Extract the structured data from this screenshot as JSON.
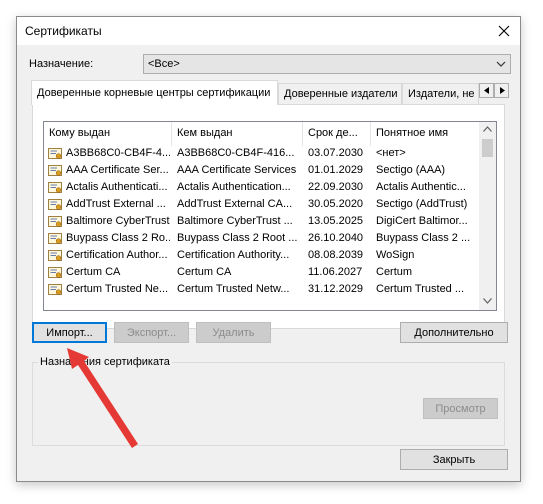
{
  "window": {
    "title": "Сертификаты"
  },
  "purpose": {
    "label": "Назначение:",
    "value": "<Все>"
  },
  "tabs": [
    {
      "label": "Доверенные корневые центры сертификации"
    },
    {
      "label": "Доверенные издатели"
    },
    {
      "label": "Издатели, не"
    }
  ],
  "table": {
    "columns": [
      "Кому выдан",
      "Кем выдан",
      "Срок де...",
      "Понятное имя"
    ],
    "rows": [
      {
        "issued_to": "A3BB68C0-CB4F-4...",
        "issued_by": "A3BB68C0-CB4F-416...",
        "expires": "03.07.2030",
        "friendly": "<нет>"
      },
      {
        "issued_to": "AAA Certificate Ser...",
        "issued_by": "AAA Certificate Services",
        "expires": "01.01.2029",
        "friendly": "Sectigo (AAA)"
      },
      {
        "issued_to": "Actalis Authenticati...",
        "issued_by": "Actalis Authentication...",
        "expires": "22.09.2030",
        "friendly": "Actalis Authentic..."
      },
      {
        "issued_to": "AddTrust External ...",
        "issued_by": "AddTrust External CA...",
        "expires": "30.05.2020",
        "friendly": "Sectigo (AddTrust)"
      },
      {
        "issued_to": "Baltimore CyberTrust...",
        "issued_by": "Baltimore CyberTrust ...",
        "expires": "13.05.2025",
        "friendly": "DigiCert Baltimor..."
      },
      {
        "issued_to": "Buypass Class 2 Ro...",
        "issued_by": "Buypass Class 2 Root ...",
        "expires": "26.10.2040",
        "friendly": "Buypass Class 2 ..."
      },
      {
        "issued_to": "Certification Author...",
        "issued_by": "Certification Authority...",
        "expires": "08.08.2039",
        "friendly": "WoSign"
      },
      {
        "issued_to": "Certum CA",
        "issued_by": "Certum CA",
        "expires": "11.06.2027",
        "friendly": "Certum"
      },
      {
        "issued_to": "Certum Trusted Ne...",
        "issued_by": "Certum Trusted Netw...",
        "expires": "31.12.2029",
        "friendly": "Certum Trusted ..."
      }
    ]
  },
  "buttons": {
    "import": "Импорт...",
    "export": "Экспорт...",
    "delete": "Удалить",
    "advanced": "Дополнительно",
    "view": "Просмотр",
    "close": "Закрыть"
  },
  "cert_purposes": {
    "title": "Назначения сертификата"
  },
  "colors": {
    "focus": "#0078d7",
    "annotation_arrow": "#e53935"
  }
}
